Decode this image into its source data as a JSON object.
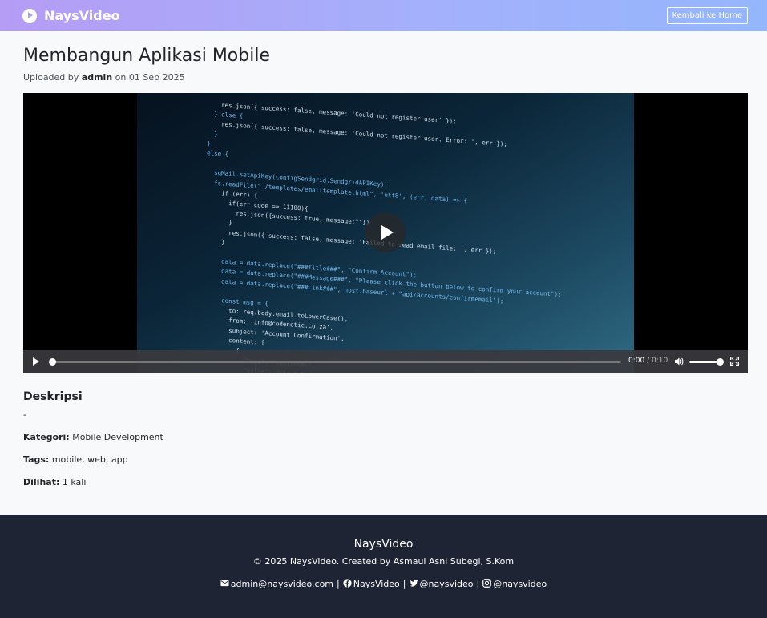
{
  "navbar": {
    "brand": "NaysVideo",
    "home_button": "Kembali ke Home",
    "colors": {
      "gradient_start": "#b59cf5",
      "gradient_end": "#94b6fd"
    }
  },
  "video": {
    "title": "Membangun Aplikasi Mobile",
    "uploaded_prefix": "Uploaded by",
    "uploader": "admin",
    "date_prefix": "on",
    "date": "01 Sep 2025",
    "current_time": "0:00",
    "duration": "/ 0:10",
    "progress": 0,
    "volume": 1.0
  },
  "description": {
    "heading": "Deskripsi",
    "text": "-",
    "category_label": "Kategori:",
    "category": "Mobile Development",
    "tags_label": "Tags:",
    "tags": "mobile, web, app",
    "views_label": "Dilihat:",
    "views": "1 kali"
  },
  "footer": {
    "brand": "NaysVideo",
    "copyright": "© 2025 NaysVideo. Created by Asmaul Asni Subegi, S.Kom",
    "email": "admin@naysvideo.com",
    "facebook": "NaysVideo",
    "twitter": "@naysvideo",
    "instagram": "@naysvideo",
    "separator": "|",
    "background": "#1e2434"
  }
}
